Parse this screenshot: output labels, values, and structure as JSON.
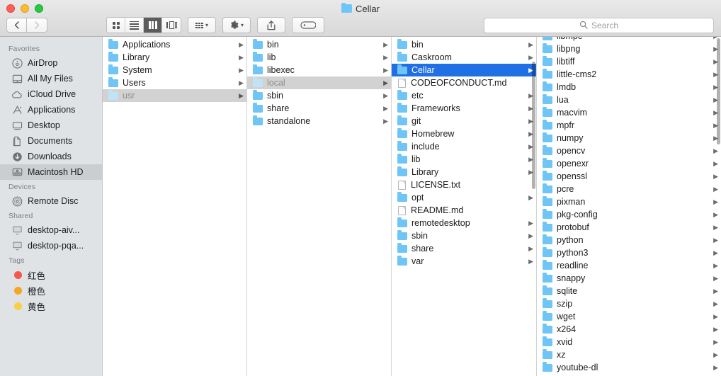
{
  "window": {
    "title": "Cellar",
    "title_icon": "folder-icon",
    "traffic_lights": [
      {
        "name": "close",
        "color": "#ff5f57"
      },
      {
        "name": "minimize",
        "color": "#febc2e"
      },
      {
        "name": "maximize",
        "color": "#28c840"
      }
    ]
  },
  "toolbar": {
    "back_label": "‹",
    "forward_label": "›",
    "view_modes": [
      {
        "name": "icon-view",
        "icon": "grid-icon",
        "active": false
      },
      {
        "name": "list-view",
        "icon": "list-icon",
        "active": false
      },
      {
        "name": "column-view",
        "icon": "columns-icon",
        "active": true
      },
      {
        "name": "gallery-view",
        "icon": "gallery-icon",
        "active": false
      }
    ],
    "arrange_icon": "arrange-grid-icon",
    "action_icon": "gear-icon",
    "share_icon": "share-icon",
    "tag_icon": "tag-icon",
    "chevron": "⌄"
  },
  "search": {
    "placeholder": "Search",
    "value": "",
    "icon": "search-icon"
  },
  "sidebar": {
    "sections": [
      {
        "header": "Favorites",
        "items": [
          {
            "label": "AirDrop",
            "icon": "airdrop-icon",
            "selected": false
          },
          {
            "label": "All My Files",
            "icon": "all-my-files-icon",
            "selected": false
          },
          {
            "label": "iCloud Drive",
            "icon": "icloud-icon",
            "selected": false
          },
          {
            "label": "Applications",
            "icon": "applications-icon",
            "selected": false
          },
          {
            "label": "Desktop",
            "icon": "desktop-icon",
            "selected": false
          },
          {
            "label": "Documents",
            "icon": "documents-icon",
            "selected": false
          },
          {
            "label": "Downloads",
            "icon": "downloads-icon",
            "selected": false
          },
          {
            "label": "Macintosh HD",
            "icon": "harddisk-icon",
            "selected": true
          }
        ]
      },
      {
        "header": "Devices",
        "items": [
          {
            "label": "Remote Disc",
            "icon": "disc-icon",
            "selected": false
          }
        ]
      },
      {
        "header": "Shared",
        "items": [
          {
            "label": "desktop-aiv...",
            "icon": "display-icon",
            "selected": false
          },
          {
            "label": "desktop-pqa...",
            "icon": "display-icon",
            "selected": false
          }
        ]
      },
      {
        "header": "Tags",
        "items": [
          {
            "label": "红色",
            "icon": "tag-dot-icon",
            "color": "#f8554b",
            "selected": false
          },
          {
            "label": "橙色",
            "icon": "tag-dot-icon",
            "color": "#f5a623",
            "selected": false
          },
          {
            "label": "黄色",
            "icon": "tag-dot-icon",
            "color": "#f7d044",
            "selected": false
          }
        ]
      }
    ]
  },
  "columns": [
    {
      "name": "column-root",
      "scrollbar": false,
      "items": [
        {
          "label": "Applications",
          "type": "folder",
          "arrow": true,
          "state": "none"
        },
        {
          "label": "Library",
          "type": "folder",
          "arrow": true,
          "state": "none"
        },
        {
          "label": "System",
          "type": "folder",
          "arrow": true,
          "state": "none"
        },
        {
          "label": "Users",
          "type": "folder",
          "arrow": true,
          "state": "none"
        },
        {
          "label": "usr",
          "type": "folder",
          "arrow": true,
          "state": "selected-inactive"
        }
      ]
    },
    {
      "name": "column-usr",
      "scrollbar": false,
      "items": [
        {
          "label": "bin",
          "type": "folder",
          "arrow": true,
          "state": "none"
        },
        {
          "label": "lib",
          "type": "folder",
          "arrow": true,
          "state": "none"
        },
        {
          "label": "libexec",
          "type": "folder",
          "arrow": true,
          "state": "none"
        },
        {
          "label": "local",
          "type": "folder",
          "arrow": true,
          "state": "selected-inactive"
        },
        {
          "label": "sbin",
          "type": "folder",
          "arrow": true,
          "state": "none"
        },
        {
          "label": "share",
          "type": "folder",
          "arrow": true,
          "state": "none"
        },
        {
          "label": "standalone",
          "type": "folder",
          "arrow": true,
          "state": "none"
        }
      ]
    },
    {
      "name": "column-local",
      "scrollbar": true,
      "items": [
        {
          "label": "bin",
          "type": "folder",
          "arrow": true,
          "state": "none"
        },
        {
          "label": "Caskroom",
          "type": "folder",
          "arrow": true,
          "state": "none"
        },
        {
          "label": "Cellar",
          "type": "folder",
          "arrow": true,
          "state": "selected-active"
        },
        {
          "label": "CODEOFCONDUCT.md",
          "type": "document",
          "arrow": false,
          "state": "none"
        },
        {
          "label": "etc",
          "type": "folder",
          "arrow": true,
          "state": "none"
        },
        {
          "label": "Frameworks",
          "type": "folder",
          "arrow": true,
          "state": "none"
        },
        {
          "label": "git",
          "type": "folder",
          "arrow": true,
          "state": "none"
        },
        {
          "label": "Homebrew",
          "type": "folder",
          "arrow": true,
          "state": "none"
        },
        {
          "label": "include",
          "type": "folder",
          "arrow": true,
          "state": "none"
        },
        {
          "label": "lib",
          "type": "folder",
          "arrow": true,
          "state": "none"
        },
        {
          "label": "Library",
          "type": "folder",
          "arrow": true,
          "state": "none"
        },
        {
          "label": "LICENSE.txt",
          "type": "document",
          "arrow": false,
          "state": "none"
        },
        {
          "label": "opt",
          "type": "folder",
          "arrow": true,
          "state": "none"
        },
        {
          "label": "README.md",
          "type": "document",
          "arrow": false,
          "state": "none"
        },
        {
          "label": "remotedesktop",
          "type": "folder",
          "arrow": true,
          "state": "none"
        },
        {
          "label": "sbin",
          "type": "folder",
          "arrow": true,
          "state": "none"
        },
        {
          "label": "share",
          "type": "folder",
          "arrow": true,
          "state": "none"
        },
        {
          "label": "var",
          "type": "folder",
          "arrow": true,
          "state": "none"
        }
      ]
    },
    {
      "name": "column-cellar",
      "scrollbar": true,
      "items": [
        {
          "label": "libmpc",
          "type": "folder",
          "arrow": true,
          "state": "none"
        },
        {
          "label": "libpng",
          "type": "folder",
          "arrow": true,
          "state": "none"
        },
        {
          "label": "libtiff",
          "type": "folder",
          "arrow": true,
          "state": "none"
        },
        {
          "label": "little-cms2",
          "type": "folder",
          "arrow": true,
          "state": "none"
        },
        {
          "label": "lmdb",
          "type": "folder",
          "arrow": true,
          "state": "none"
        },
        {
          "label": "lua",
          "type": "folder",
          "arrow": true,
          "state": "none"
        },
        {
          "label": "macvim",
          "type": "folder",
          "arrow": true,
          "state": "none"
        },
        {
          "label": "mpfr",
          "type": "folder",
          "arrow": true,
          "state": "none"
        },
        {
          "label": "numpy",
          "type": "folder",
          "arrow": true,
          "state": "none"
        },
        {
          "label": "opencv",
          "type": "folder",
          "arrow": true,
          "state": "none"
        },
        {
          "label": "openexr",
          "type": "folder",
          "arrow": true,
          "state": "none"
        },
        {
          "label": "openssl",
          "type": "folder",
          "arrow": true,
          "state": "none"
        },
        {
          "label": "pcre",
          "type": "folder",
          "arrow": true,
          "state": "none"
        },
        {
          "label": "pixman",
          "type": "folder",
          "arrow": true,
          "state": "none"
        },
        {
          "label": "pkg-config",
          "type": "folder",
          "arrow": true,
          "state": "none"
        },
        {
          "label": "protobuf",
          "type": "folder",
          "arrow": true,
          "state": "none"
        },
        {
          "label": "python",
          "type": "folder",
          "arrow": true,
          "state": "none"
        },
        {
          "label": "python3",
          "type": "folder",
          "arrow": true,
          "state": "none"
        },
        {
          "label": "readline",
          "type": "folder",
          "arrow": true,
          "state": "none"
        },
        {
          "label": "snappy",
          "type": "folder",
          "arrow": true,
          "state": "none"
        },
        {
          "label": "sqlite",
          "type": "folder",
          "arrow": true,
          "state": "none"
        },
        {
          "label": "szip",
          "type": "folder",
          "arrow": true,
          "state": "none"
        },
        {
          "label": "wget",
          "type": "folder",
          "arrow": true,
          "state": "none"
        },
        {
          "label": "x264",
          "type": "folder",
          "arrow": true,
          "state": "none"
        },
        {
          "label": "xvid",
          "type": "folder",
          "arrow": true,
          "state": "none"
        },
        {
          "label": "xz",
          "type": "folder",
          "arrow": true,
          "state": "none"
        },
        {
          "label": "youtube-dl",
          "type": "folder",
          "arrow": true,
          "state": "none"
        }
      ]
    }
  ],
  "colors": {
    "accent": "#1f6fe5",
    "folder": "#6fc5f5",
    "sidebar_bg": "#dfe3e6"
  }
}
